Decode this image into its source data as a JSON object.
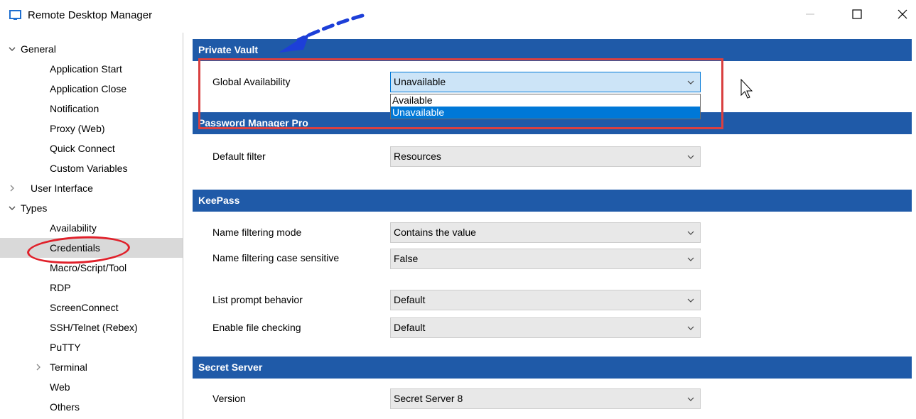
{
  "window": {
    "title": "Remote Desktop Manager",
    "minimize_icon": "minimize-icon",
    "maximize_icon": "maximize-icon",
    "close_icon": "close-icon"
  },
  "sidebar": {
    "items": [
      {
        "label": "General",
        "expander": "expanded"
      },
      {
        "label": "Application Start"
      },
      {
        "label": "Application Close"
      },
      {
        "label": "Notification"
      },
      {
        "label": "Proxy (Web)"
      },
      {
        "label": "Quick Connect"
      },
      {
        "label": "Custom Variables"
      },
      {
        "label": "User Interface",
        "expander": "collapsed"
      },
      {
        "label": "Types",
        "expander": "expanded"
      },
      {
        "label": "Availability"
      },
      {
        "label": "Credentials",
        "selected": true
      },
      {
        "label": "Macro/Script/Tool"
      },
      {
        "label": "RDP"
      },
      {
        "label": "ScreenConnect"
      },
      {
        "label": "SSH/Telnet (Rebex)"
      },
      {
        "label": "PuTTY"
      },
      {
        "label": "Terminal",
        "expander": "collapsed"
      },
      {
        "label": "Web"
      },
      {
        "label": "Others"
      }
    ]
  },
  "sections": {
    "private_vault": {
      "title": "Private Vault",
      "global_availability": {
        "label": "Global Availability",
        "value": "Unavailable",
        "options": [
          "Available",
          "Unavailable"
        ]
      }
    },
    "password_manager_pro": {
      "title": "Password Manager Pro",
      "default_filter": {
        "label": "Default filter",
        "value": "Resources"
      }
    },
    "keepass": {
      "title": "KeePass",
      "name_filtering_mode": {
        "label": "Name filtering mode",
        "value": "Contains the value"
      },
      "name_filtering_case": {
        "label": "Name filtering case sensitive",
        "value": "False"
      },
      "list_prompt": {
        "label": "List prompt behavior",
        "value": "Default"
      },
      "file_checking": {
        "label": "Enable file checking",
        "value": "Default"
      }
    },
    "secret_server": {
      "title": "Secret Server",
      "version": {
        "label": "Version",
        "value": "Secret Server 8"
      }
    }
  },
  "colors": {
    "section_header": "#1f5aa8",
    "highlight": "#0078d7",
    "annotation_red": "#d94040",
    "arrow_blue": "#1d3fd8"
  }
}
